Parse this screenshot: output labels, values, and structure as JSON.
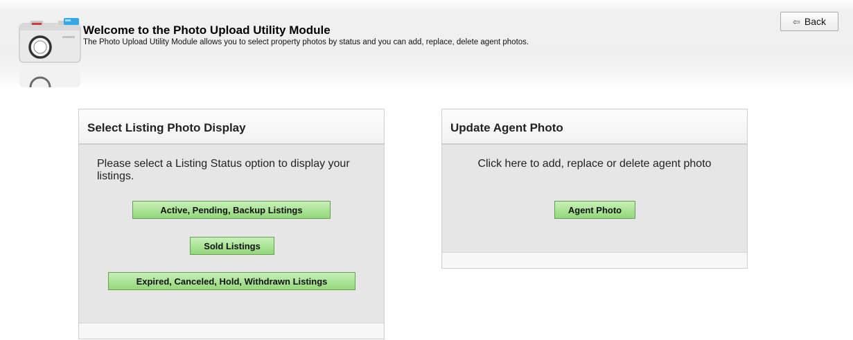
{
  "header": {
    "title": "Welcome to the Photo Upload Utility Module",
    "description": "The Photo Upload Utility Module allows you to select property photos by status and you can add, replace, delete agent photos.",
    "back_label": "Back",
    "icon": "camera-icon"
  },
  "listing_panel": {
    "title": "Select Listing Photo Display",
    "instructions": "Please select a Listing Status option to display your listings.",
    "buttons": [
      "Active, Pending, Backup Listings",
      "Sold Listings",
      "Expired, Canceled, Hold, Withdrawn Listings"
    ]
  },
  "agent_panel": {
    "title": "Update Agent Photo",
    "instructions": "Click here to add, replace or delete agent photo",
    "button": "Agent Photo"
  },
  "colors": {
    "button_green": "#a9e394",
    "panel_bg": "#e6e6e6"
  }
}
